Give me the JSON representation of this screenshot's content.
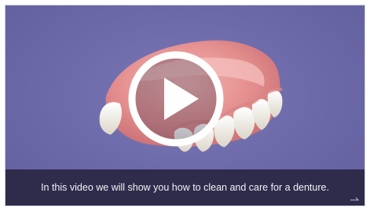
{
  "player": {
    "caption": "In this video we will show you how to clean and care for a denture.",
    "play_icon": "play-icon",
    "fullscreen_icon": "fullscreen-icon",
    "thumbnail_subject": "denture",
    "colors": {
      "background": "#6b68a8",
      "caption_bar": "#2e2c4a",
      "caption_text": "#f2f2f7",
      "gum": "#e79a99",
      "teeth": "#f4f1ea",
      "play_ring": "#ffffff"
    }
  }
}
